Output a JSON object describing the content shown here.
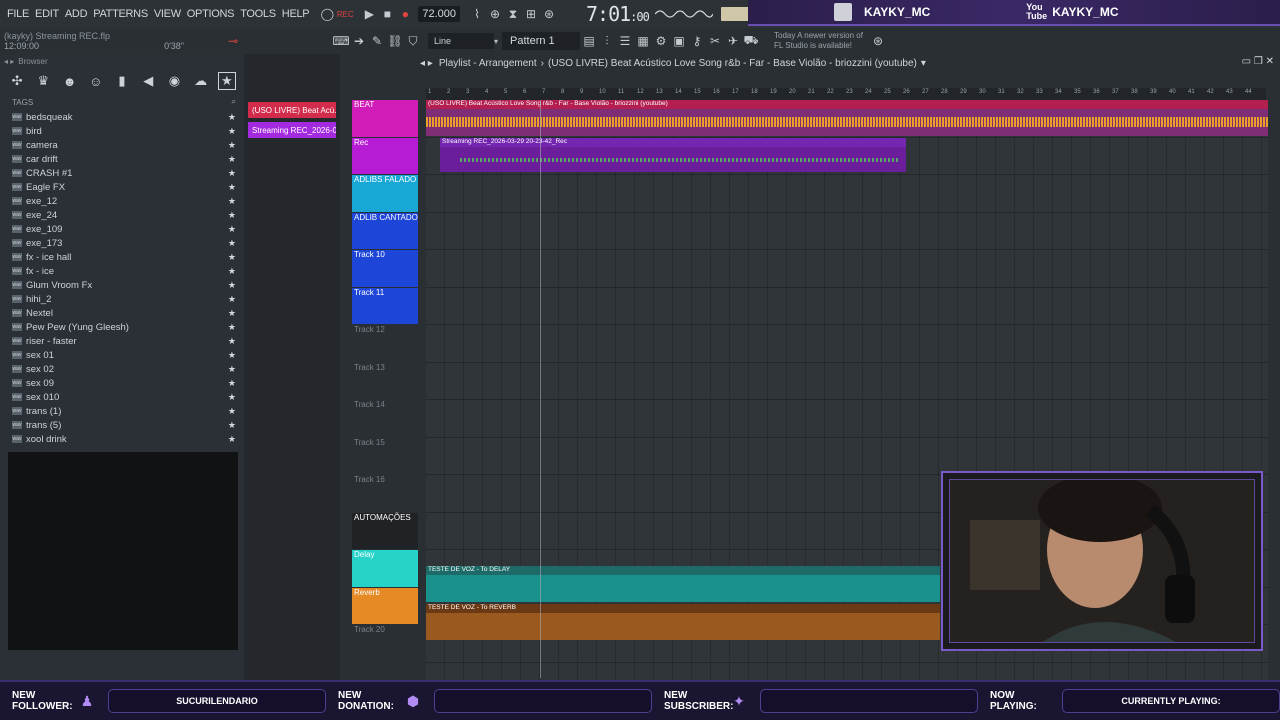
{
  "menu": [
    "FILE",
    "EDIT",
    "ADD",
    "PATTERNS",
    "VIEW",
    "OPTIONS",
    "TOOLS",
    "HELP"
  ],
  "transport": {
    "tempo": "72.000",
    "time": "7:01",
    "time_ms": "00",
    "cpu_label": "32"
  },
  "stream": {
    "twitch_name": "KAYKY_MC",
    "youtube_name": "KAYKY_MC"
  },
  "project": {
    "file": "(kayky) Streaming REC.flp",
    "time": "12:09:00",
    "len": "0'38\""
  },
  "toolbar": {
    "snap": "Line",
    "pattern": "Pattern 1",
    "news_line1": "Today   A newer version of",
    "news_line2": "FL Studio is available!"
  },
  "browser": {
    "title": "Browser",
    "tags_label": "TAGS",
    "items": [
      "bedsqueak",
      "bird",
      "camera",
      "car drift",
      "CRASH #1",
      "Eagle FX",
      "exe_12",
      "exe_24",
      "exe_109",
      "exe_173",
      "fx - ice hall",
      "fx - ice",
      "Glum Vroom Fx",
      "hihi_2",
      "Nextel",
      "Pew Pew (Yung Gleesh)",
      "riser - faster",
      "sex 01",
      "sex 02",
      "sex 09",
      "sex 010",
      "trans  (1)",
      "trans  (5)",
      "xool drink"
    ]
  },
  "channels": {
    "clip1": "(USO LIVRE) Beat Acú...",
    "clip2": "Streaming REC_2026-03-..."
  },
  "playlist": {
    "title": "Playlist - Arrangement",
    "song": "(USO LIVRE) Beat Acústico Love Song r&b - Far - Base Violão - briozzini (youtube)",
    "ruler": [
      "1",
      "2",
      "3",
      "4",
      "5",
      "6",
      "7",
      "8",
      "9",
      "10",
      "11",
      "12",
      "13",
      "14",
      "15",
      "16",
      "17",
      "18",
      "19",
      "20",
      "21",
      "22",
      "23",
      "24",
      "25",
      "26",
      "27",
      "28",
      "29",
      "30",
      "31",
      "32",
      "33",
      "34",
      "35",
      "36",
      "37",
      "38",
      "39",
      "40",
      "41",
      "42",
      "43",
      "44"
    ],
    "tracks": [
      {
        "name": "BEAT",
        "color": "#d21cb8"
      },
      {
        "name": "Rec",
        "color": "#b51cd4"
      },
      {
        "name": "ADLIBS FALADO",
        "color": "#19a7d6"
      },
      {
        "name": "ADLIB CANTADO",
        "color": "#1d46d8"
      },
      {
        "name": "Track 10",
        "color": "#1d46d8"
      },
      {
        "name": "Track 11",
        "color": "#1d46d8"
      },
      {
        "name": "Track 12",
        "color": ""
      },
      {
        "name": "Track 13",
        "color": ""
      },
      {
        "name": "Track 14",
        "color": ""
      },
      {
        "name": "Track 15",
        "color": ""
      },
      {
        "name": "Track 16",
        "color": ""
      },
      {
        "name": "AUTOMAÇÕES",
        "color": "#202326"
      },
      {
        "name": "Delay",
        "color": "#25d3c9"
      },
      {
        "name": "Reverb",
        "color": "#e58a25"
      },
      {
        "name": "Track 20",
        "color": ""
      }
    ],
    "clip_beat": "(USO LIVRE) Beat Acústico Love Song r&b - Far - Base Violão - briozzini (youtube)",
    "clip_rec": "Streaming REC_2026-03-29 20-23-42_Rec",
    "clip_delay": "TESTE DE VOZ - To DELAY",
    "clip_reverb": "TESTE DE VOZ - To REVERB"
  },
  "footer": {
    "new_follower_l1": "NEW",
    "new_follower_l2": "FOLLOWER:",
    "follower_value": "SUCURILENDARIO",
    "new_donation_l1": "NEW",
    "new_donation_l2": "DONATION:",
    "donation_value": "",
    "new_subscriber_l1": "NEW",
    "new_subscriber_l2": "SUBSCRIBER:",
    "subscriber_value": "",
    "now_playing_l1": "NOW",
    "now_playing_l2": "PLAYING:",
    "now_playing_value": "CURRENTLY PLAYING:"
  }
}
